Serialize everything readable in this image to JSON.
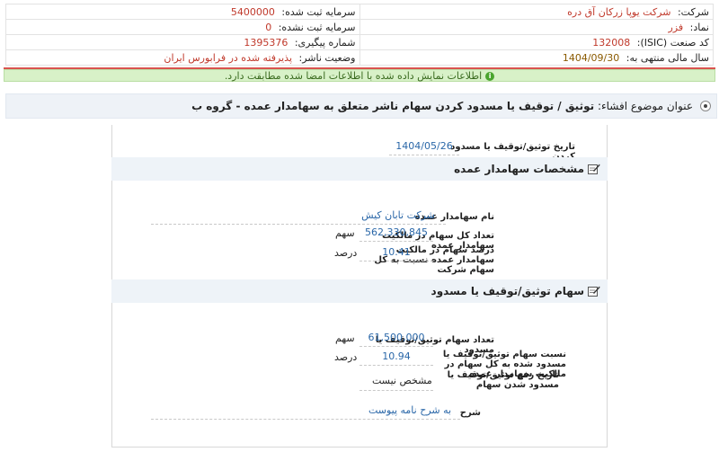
{
  "header": {
    "company_label": "شرکت:",
    "company_value": "شرکت یوپا زرکان آق دره",
    "registered_capital_label": "سرمایه ثبت شده:",
    "registered_capital_value": "5400000",
    "symbol_label": "نماد:",
    "symbol_value": "فزر",
    "unregistered_capital_label": "سرمایه ثبت نشده:",
    "unregistered_capital_value": "0",
    "isic_label": "کد صنعت (ISIC):",
    "isic_value": "132008",
    "tracking_label": "شماره پیگیری:",
    "tracking_value": "1395376",
    "fiscal_year_label": "سال مالی منتهی به:",
    "fiscal_year_value": "1404/09/30",
    "publisher_status_label": "وضعیت ناشر:",
    "publisher_status_value": "پذیرفته شده در فرابورس ایران"
  },
  "notice": {
    "text": "اطلاعات نمایش داده شده با اطلاعات امضا شده مطابقت دارد."
  },
  "subject": {
    "label": "عنوان موضوع افشاء:",
    "value": "توثیق / توقیف یا مسدود کردن سهام ناشر متعلق به سهامدار عمده - گروه ب"
  },
  "form": {
    "date_label": "تاریخ توثیق/توقیف یا مسدود کردن",
    "date_value": "1404/05/26",
    "section1_title": "مشخصات سهامدار عمده",
    "holder_name_label": "نام سهامدار عمده",
    "holder_name_value": "شرکت تابان کیش",
    "total_shares_label": "تعداد کل سهام در مالکیت سهامدار عمده",
    "total_shares_value": "562,330,845",
    "total_shares_unit": "سهم",
    "percent_label": "درصد سهام در مالکیت سهامدار عمده نسبت به کل سهام شرکت",
    "percent_value": "10.41",
    "percent_unit": "درصد",
    "section2_title": "سهام توثیق/توقیف یا مسدود",
    "pledged_count_label": "تعداد سهام توثیق/توقیف یا مسدود",
    "pledged_count_value": "61,500,000",
    "pledged_count_unit": "سهم",
    "pledged_ratio_label": "نسبت سهام توثیق/توقیف یا مسدود شده به کل سهام در مالکیت سهامدار عمده",
    "pledged_ratio_value": "10.94",
    "pledged_ratio_unit": "درصد",
    "release_date_label": "تاریخ رفع توثیق/توقیف یا مسدود شدن سهام",
    "release_date_value": "مشخص نیست",
    "description_label": "شرح",
    "description_value": "به شرح نامه پیوست"
  },
  "colors": {
    "accent_value": "#2a67a8",
    "header_value": "#c0392b",
    "notice_bg": "#d8f1c8",
    "alert_line": "#d9534f"
  },
  "icons": [
    "info-icon",
    "radio-icon",
    "edit-icon"
  ]
}
